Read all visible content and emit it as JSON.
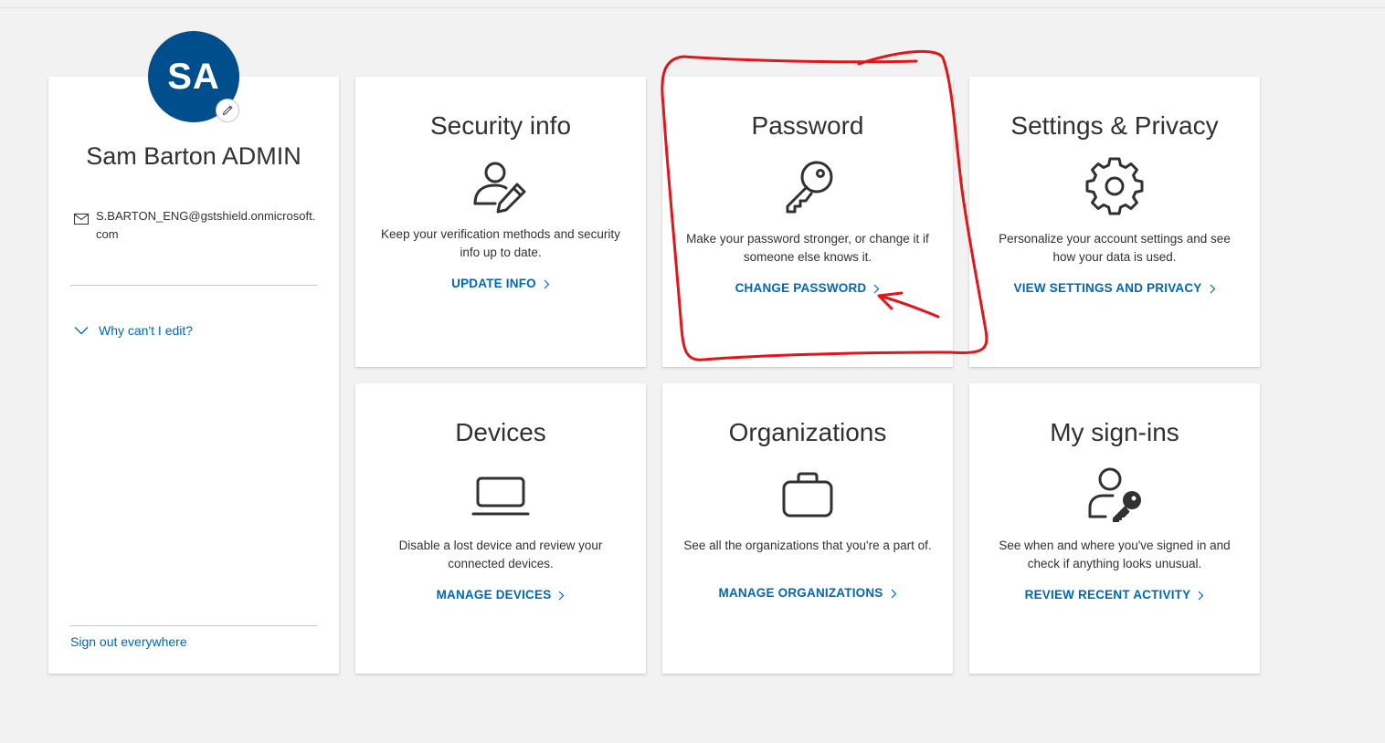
{
  "profile": {
    "initials": "SA",
    "name": "Sam Barton ADMIN",
    "email": "S.BARTON_ENG@gstshield.onmicrosoft.com",
    "why_label": "Why can't I edit?",
    "sign_out_label": "Sign out everywhere",
    "avatar_color": "#004e8c"
  },
  "tiles": [
    {
      "title": "Security info",
      "icon": "user-edit-icon",
      "description": "Keep your verification methods and security info up to date.",
      "link": "UPDATE INFO"
    },
    {
      "title": "Password",
      "icon": "key-icon",
      "description": "Make your password stronger, or change it if someone else knows it.",
      "link": "CHANGE PASSWORD"
    },
    {
      "title": "Settings & Privacy",
      "icon": "gear-icon",
      "description": "Personalize your account settings and see how your data is used.",
      "link": "VIEW SETTINGS AND PRIVACY"
    },
    {
      "title": "Devices",
      "icon": "laptop-icon",
      "description": "Disable a lost device and review your connected devices.",
      "link": "MANAGE DEVICES"
    },
    {
      "title": "Organizations",
      "icon": "briefcase-icon",
      "description": "See all the organizations that you're a part of.",
      "link": "MANAGE ORGANIZATIONS"
    },
    {
      "title": "My sign-ins",
      "icon": "user-key-icon",
      "description": "See when and where you've signed in and check if anything looks unusual.",
      "link": "REVIEW RECENT ACTIVITY"
    }
  ],
  "colors": {
    "link": "#0067b8",
    "annotation": "#e0161b",
    "background": "#f2f2f2"
  }
}
